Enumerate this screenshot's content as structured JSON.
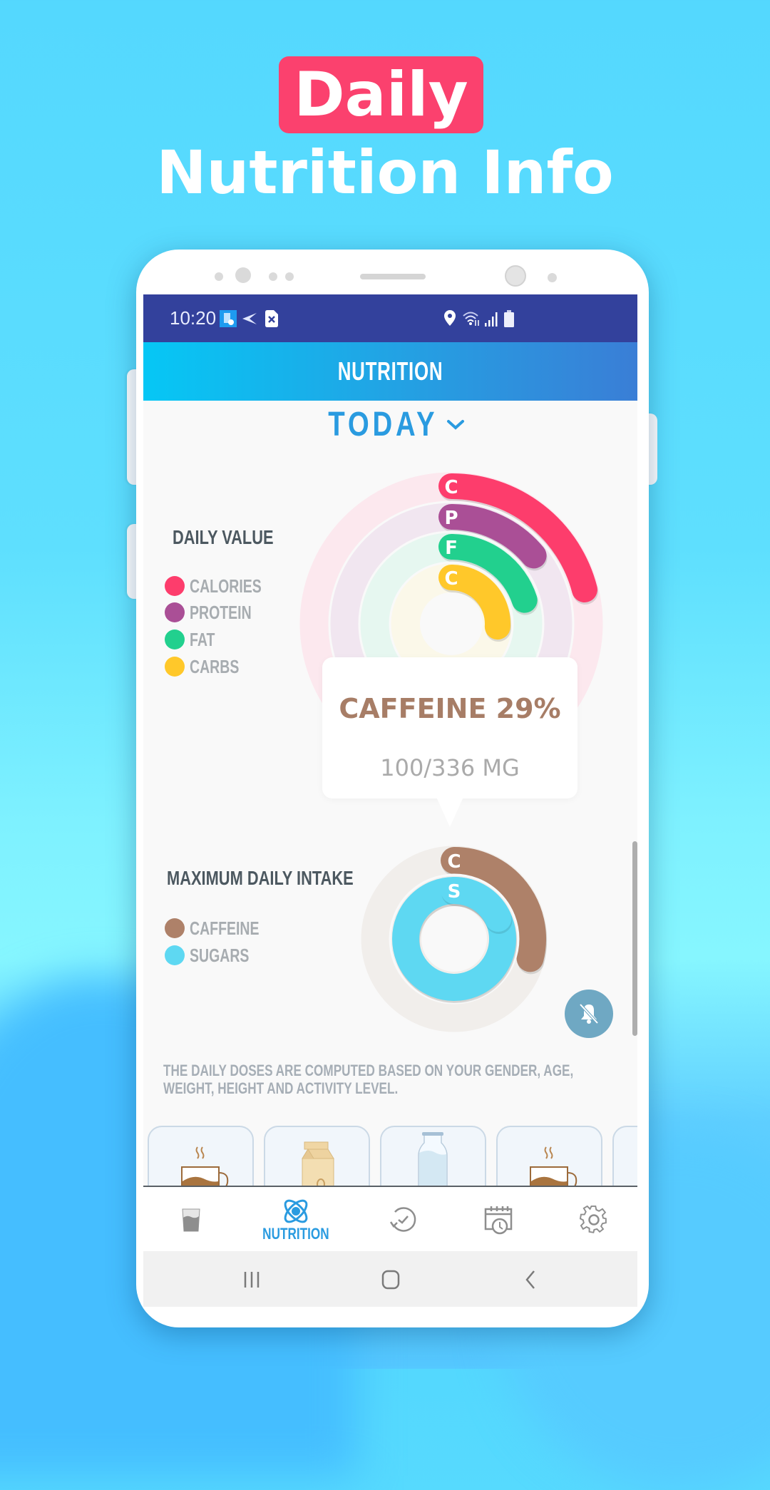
{
  "promo": {
    "badge": "Daily",
    "title": "Nutrition Info"
  },
  "status_bar": {
    "time": "10:20",
    "left_icons": [
      "app-notification-icon",
      "send-icon",
      "sim-error-icon"
    ],
    "right_icons": [
      "location-icon",
      "wifi-icon",
      "signal-icon",
      "battery-icon"
    ]
  },
  "header": {
    "title": "NUTRITION"
  },
  "period_selector": {
    "label": "TODAY",
    "icon": "chevron-down-icon"
  },
  "daily_value": {
    "title": "DAILY VALUE",
    "legend": [
      {
        "label": "CALORIES",
        "color": "#FD3D6C"
      },
      {
        "label": "PROTEIN",
        "color": "#AA4F96"
      },
      {
        "label": "FAT",
        "color": "#22D08E"
      },
      {
        "label": "CARBS",
        "color": "#FFC82A"
      }
    ]
  },
  "tooltip": {
    "title": "CAFFEINE 29%",
    "subtitle": "100/336 MG"
  },
  "max_daily_intake": {
    "title": "MAXIMUM DAILY INTAKE",
    "legend": [
      {
        "label": "CAFFEINE",
        "color": "#AE8169"
      },
      {
        "label": "SUGARS",
        "color": "#5ED8F2"
      }
    ]
  },
  "fab": {
    "icon": "bell-off-icon"
  },
  "footnote": "THE DAILY DOSES ARE COMPUTED BASED ON YOUR GENDER, AGE, WEIGHT, HEIGHT AND ACTIVITY LEVEL.",
  "drinks": [
    {
      "icon": "coffee-cup-icon"
    },
    {
      "icon": "soy-milk-carton-icon"
    },
    {
      "icon": "milk-bottle-icon"
    },
    {
      "icon": "coffee-cup-icon"
    },
    {
      "icon": "drink-icon"
    }
  ],
  "bottom_nav": {
    "items": [
      {
        "icon": "water-glass-icon",
        "label": "",
        "active": false
      },
      {
        "icon": "atom-icon",
        "label": "NUTRITION",
        "active": true
      },
      {
        "icon": "history-icon",
        "label": "",
        "active": false
      },
      {
        "icon": "calendar-clock-icon",
        "label": "",
        "active": false
      },
      {
        "icon": "gear-icon",
        "label": "",
        "active": false
      }
    ]
  },
  "system_nav": {
    "items": [
      "recents-icon",
      "home-icon",
      "back-icon"
    ]
  },
  "chart_data": [
    {
      "type": "radial-bar",
      "title": "DAILY VALUE",
      "unit": "percent of daily value",
      "series": [
        {
          "name": "CALORIES",
          "short": "C",
          "value": 21,
          "color": "#FD3D6C",
          "track": "#FCE8EE"
        },
        {
          "name": "PROTEIN",
          "short": "P",
          "value": 14,
          "color": "#AA4F96",
          "track": "#F1E6F0"
        },
        {
          "name": "FAT",
          "short": "F",
          "value": 20,
          "color": "#22D08E",
          "track": "#E6F7F0"
        },
        {
          "name": "CARBS",
          "short": "C",
          "value": 26,
          "color": "#FFC82A",
          "track": "#FBF8E9"
        }
      ],
      "range": [
        0,
        100
      ]
    },
    {
      "type": "radial-bar",
      "title": "MAXIMUM DAILY INTAKE",
      "unit": "percent of maximum daily intake",
      "series": [
        {
          "name": "CAFFEINE",
          "short": "C",
          "value": 29,
          "color": "#AE8169",
          "track": "#F1EEEB",
          "amount": 100,
          "max": 336,
          "amount_unit": "MG"
        },
        {
          "name": "SUGARS",
          "short": "S",
          "value": 118,
          "color": "#5ED8F2",
          "track": "#F1EEEB"
        }
      ],
      "range": [
        0,
        100
      ]
    }
  ]
}
